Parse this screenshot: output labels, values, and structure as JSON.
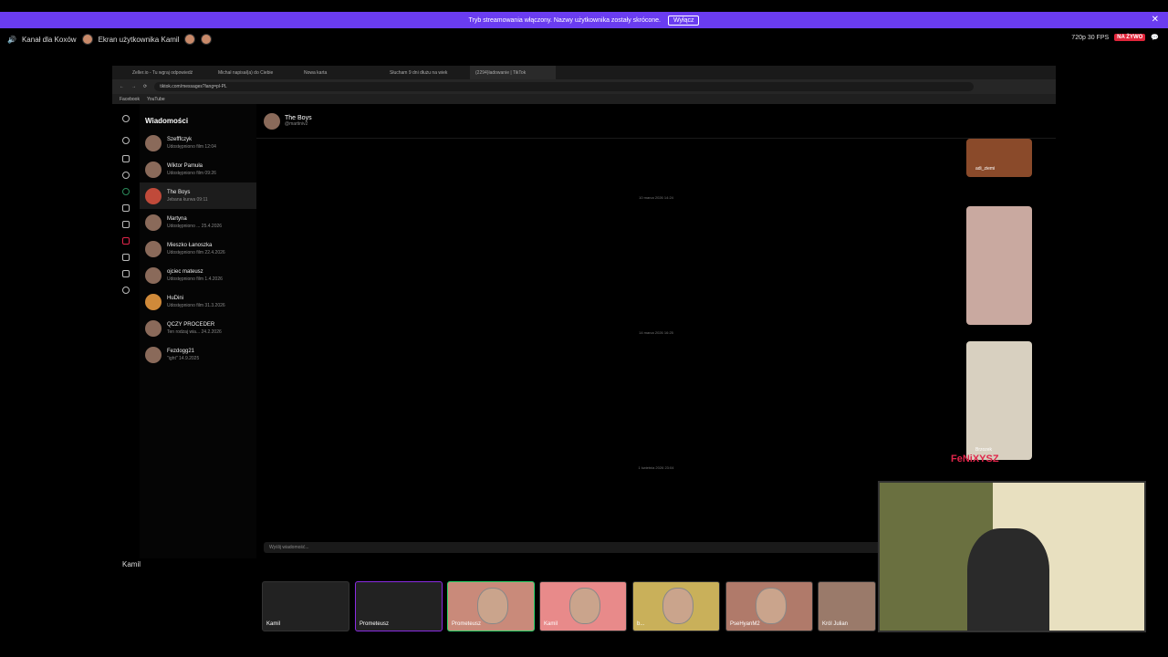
{
  "banner": {
    "text": "Tryb streamowania włączony. Nazwy użytkownika zostały skrócone.",
    "button": "Wyłącz"
  },
  "topbar": {
    "channel": "Kanał dla Koxów",
    "screen": "Ekran użytkownika Kamil",
    "quality": "720p 30 FPS",
    "live": "NA ŻYWO"
  },
  "tabs": [
    "Zeller.io - Tu wgraj odpowiedź",
    "Michał napisał(a) do Ciebie",
    "Nowa karta",
    "Słucham 9 dni dłużu na wiek",
    "(2294)ładowanie | TikTok"
  ],
  "url": "tiktok.com/messages?lang=pl-PL",
  "bookmarks": [
    "Facebook",
    "YouTube"
  ],
  "sidebar": {
    "title": "Wiadomości",
    "convs": [
      {
        "name": "Szefffczyk",
        "sub": "Udostępniono film 12:04"
      },
      {
        "name": "Wiktor Pamuła",
        "sub": "Udostępniono film 09:26"
      },
      {
        "name": "The Boys",
        "sub": "Jebana kurwa 09:11"
      },
      {
        "name": "Martyna",
        "sub": "Udostępniono ... 25.4.2026"
      },
      {
        "name": "Mieszko Łanoszka",
        "sub": "Udostępniono film 22.4.2026"
      },
      {
        "name": "ojciec mateusz",
        "sub": "Udostępniono film 1.4.2026"
      },
      {
        "name": "HuDini",
        "sub": "Udostępniono film 31.3.2026"
      },
      {
        "name": "QCZY PROCEDER",
        "sub": "Ten rodzaj wia... 24.2.2026"
      },
      {
        "name": "Fezdogg21",
        "sub": "\"ight\" 14.9.2025"
      }
    ]
  },
  "chat": {
    "name": "The Boys",
    "handle": "@martiniv2",
    "ts1": "10 marca 2026 14:24",
    "ts2": "14 marca 2026 16:25",
    "ts3": "1 kwietnia 2026 23:04",
    "placeholder": "Wyślij wiadomość...",
    "thumb1": "adi_ziemi",
    "thumb3": "Brzozek"
  },
  "stream": {
    "user": "Kamil",
    "fenix": "FeNiXYSZ",
    "tiles": [
      "Kamil",
      "Prometeusz",
      "Prometeusz",
      "Kamil",
      "b...",
      "PseHyanM2",
      "Król Julian"
    ]
  }
}
